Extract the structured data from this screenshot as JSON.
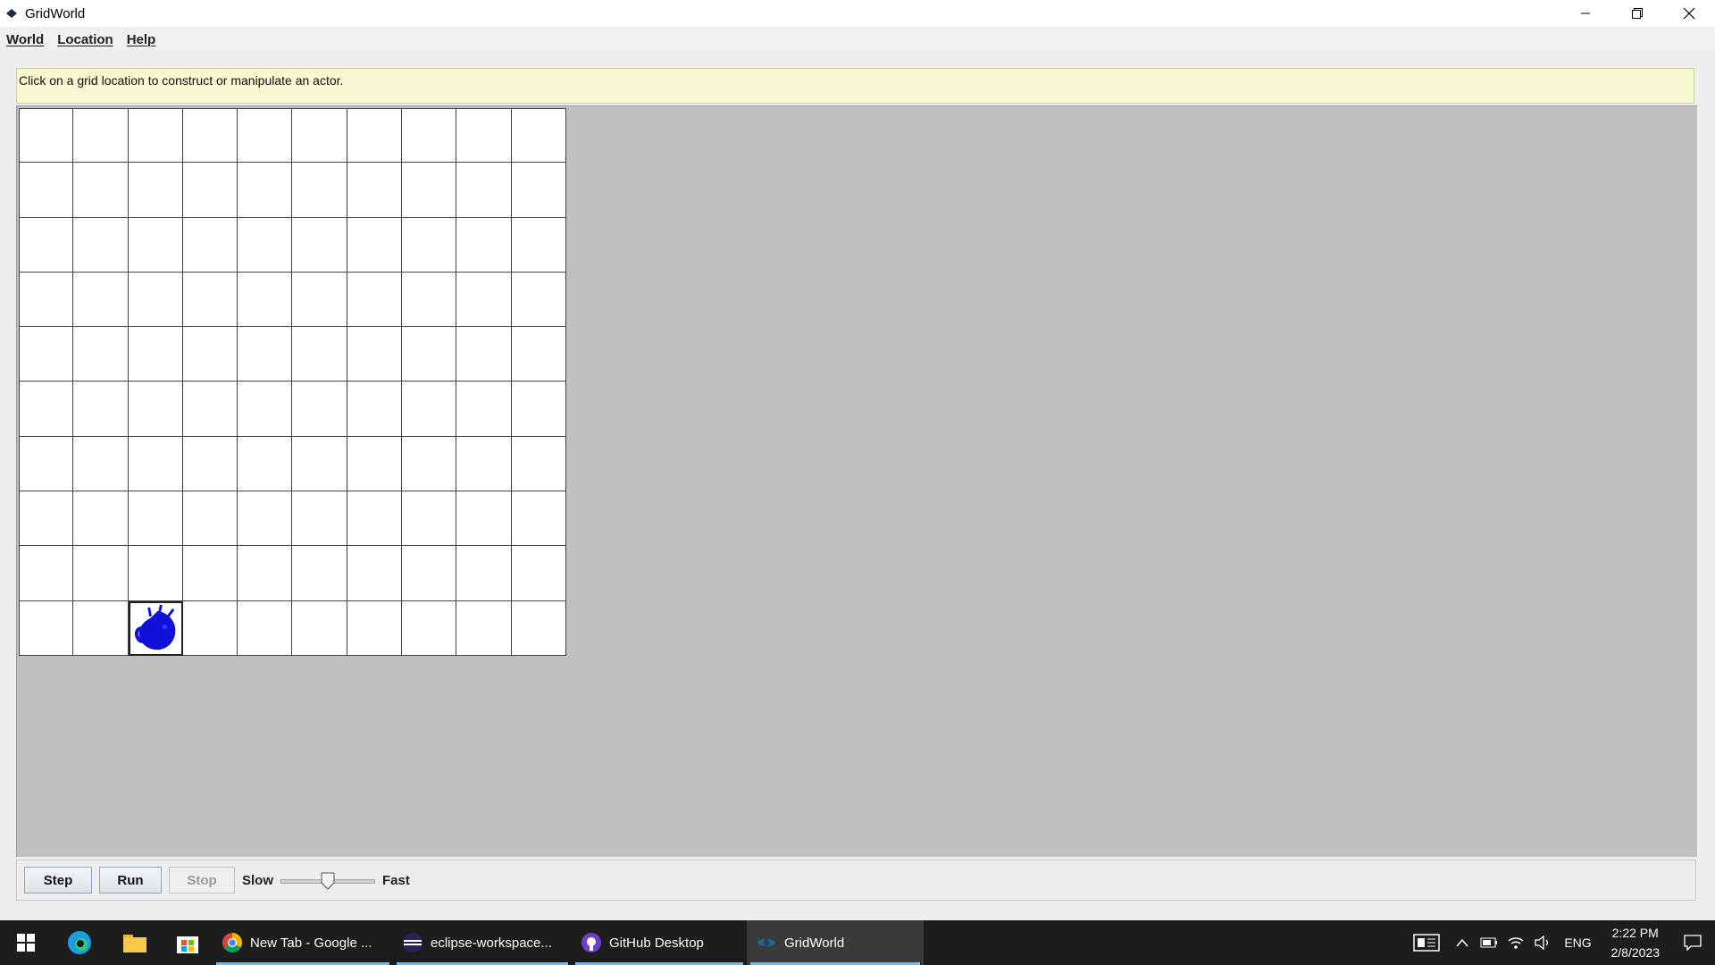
{
  "window": {
    "title": "GridWorld"
  },
  "menu": {
    "items": [
      "World",
      "Location",
      "Help"
    ]
  },
  "message": "Click on a grid location to construct or manipulate an actor.",
  "grid": {
    "rows": 10,
    "cols": 10,
    "actor": {
      "row": 9,
      "col": 2,
      "color": "#1010d8"
    }
  },
  "controls": {
    "step": "Step",
    "run": "Run",
    "stop": "Stop",
    "slow": "Slow",
    "fast": "Fast",
    "speed_fraction": 0.5
  },
  "taskbar": {
    "apps": [
      {
        "label": "New Tab - Google ...",
        "icon": "chrome-icon"
      },
      {
        "label": "eclipse-workspace...",
        "icon": "eclipse-icon"
      },
      {
        "label": "GitHub Desktop",
        "icon": "github-icon"
      },
      {
        "label": "GridWorld",
        "icon": "gridworld-icon"
      }
    ],
    "language": "ENG",
    "time": "2:22 PM",
    "date": "2/8/2023"
  }
}
